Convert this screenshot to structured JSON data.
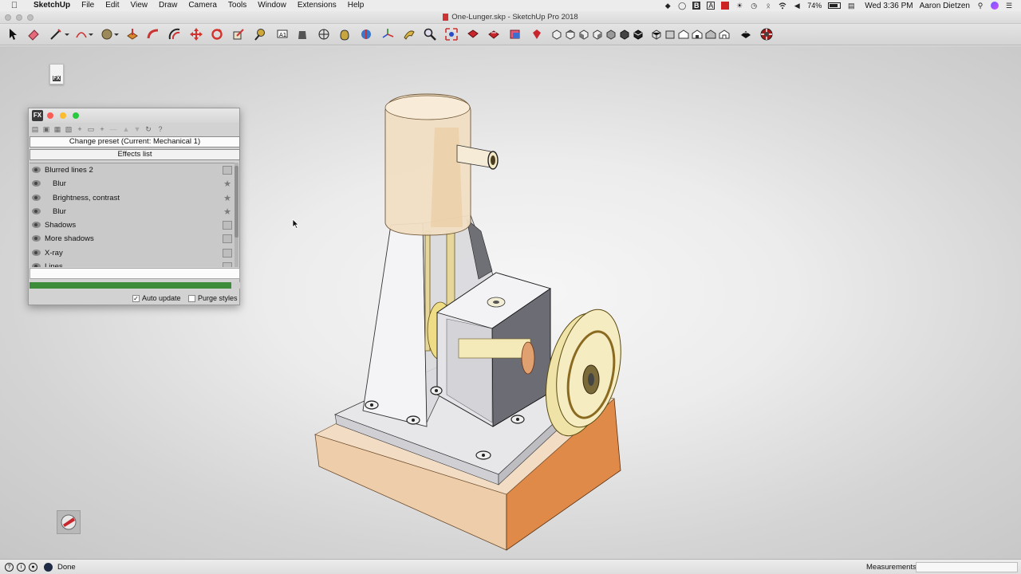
{
  "menubar": {
    "app": "SketchUp",
    "items": [
      "File",
      "Edit",
      "View",
      "Draw",
      "Camera",
      "Tools",
      "Window",
      "Extensions",
      "Help"
    ],
    "battery": "74%",
    "clock": "Wed 3:36 PM",
    "user": "Aaron Dietzen"
  },
  "window": {
    "title": "One-Lunger.skp - SketchUp Pro 2018"
  },
  "toolbar": {
    "tools": [
      "select",
      "eraser",
      "line",
      "arc",
      "circle",
      "push-pull",
      "follow-me",
      "offset",
      "move",
      "rotate",
      "scale",
      "tape-measure",
      "text",
      "paint-bucket",
      "orbit",
      "pan",
      "axes",
      "sandbox",
      "zoom",
      "zoom-extents",
      "section-plane",
      "display-section",
      "component",
      "warehouse",
      "iso",
      "top",
      "front",
      "right",
      "back",
      "left",
      "bottom",
      "xray",
      "wireframe",
      "hidden-line",
      "shaded",
      "textured",
      "monochrome",
      "style",
      "extension"
    ]
  },
  "fx_panel": {
    "badge": "FX",
    "preset_button": "Change preset (Current: Mechanical 1)",
    "effects_button": "Effects list",
    "effects": [
      {
        "label": "Blurred lines 2",
        "child": false,
        "icon": "image"
      },
      {
        "label": "Blur",
        "child": true,
        "icon": "star"
      },
      {
        "label": "Brightness, contrast",
        "child": true,
        "icon": "star"
      },
      {
        "label": "Blur",
        "child": true,
        "icon": "star"
      },
      {
        "label": "Shadows",
        "child": false,
        "icon": "image"
      },
      {
        "label": "More shadows",
        "child": false,
        "icon": "image"
      },
      {
        "label": "X-ray",
        "child": false,
        "icon": "image"
      },
      {
        "label": "Lines",
        "child": false,
        "icon": "image"
      }
    ],
    "progress": 0.96,
    "auto_update_label": "Auto update",
    "auto_update_checked": true,
    "purge_styles_label": "Purge styles",
    "purge_styles_checked": false
  },
  "statusbar": {
    "status": "Done",
    "measurements_label": "Measurements"
  },
  "colors": {
    "progress_green": "#3c8c3a",
    "flywheel": "#f3eab8",
    "base_wood": "#e8a062"
  }
}
